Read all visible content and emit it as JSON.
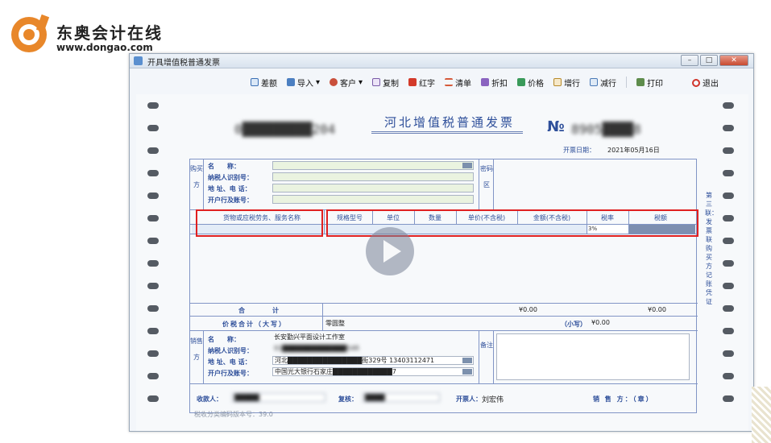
{
  "brand": {
    "name": "东奥会计在线",
    "url": "www.dongao.com",
    "accent": "#e8872a"
  },
  "window": {
    "title": "开具增值税普通发票",
    "min_icon": "minimize-icon",
    "max_icon": "maximize-icon",
    "close_icon": "close-icon"
  },
  "toolbar": {
    "items": [
      {
        "label": "差额",
        "icon": "diff-icon"
      },
      {
        "label": "导入",
        "icon": "import-icon",
        "arrow": "▾"
      },
      {
        "label": "客户",
        "icon": "customer-icon",
        "arrow": "▾"
      },
      {
        "label": "复制",
        "icon": "copy-icon"
      },
      {
        "label": "红字",
        "icon": "red-letter-icon"
      },
      {
        "label": "清单",
        "icon": "list-icon"
      },
      {
        "label": "折扣",
        "icon": "discount-icon"
      },
      {
        "label": "价格",
        "icon": "price-icon"
      },
      {
        "label": "增行",
        "icon": "add-row-icon"
      },
      {
        "label": "减行",
        "icon": "remove-row-icon"
      },
      {
        "label": "打印",
        "icon": "print-icon"
      }
    ],
    "exit_label": "退出"
  },
  "invoice": {
    "title": "河北增值税普通发票",
    "code_left": "0█████████204",
    "no_mark": "№",
    "no_value": "8905████8",
    "date_label": "开票日期：",
    "date_value": "2021年05月16日",
    "buyer": {
      "side": "购买方",
      "name_label": "名　　称：",
      "tax_label": "纳税人识别号：",
      "addr_label": "地 址、电 话：",
      "bank_label": "开户行及账号："
    },
    "cipher_side": "密码区",
    "grid": {
      "headers": [
        "货物或应税劳务、服务名称",
        "规格型号",
        "单位",
        "数量",
        "单价(不含税)",
        "金额(不含税)",
        "税率",
        "税额"
      ],
      "row": [
        "",
        "",
        "",
        "",
        "",
        "",
        "3%",
        ""
      ]
    },
    "totals": {
      "label": "合　　计",
      "amount": "¥0.00",
      "tax": "¥0.00"
    },
    "total_in_words": {
      "label": "价税合计（大写）",
      "value": "零圆整",
      "small_label": "（小写）",
      "small_value": "¥0.00"
    },
    "seller": {
      "side": "销售方",
      "name_label": "名　　称：",
      "name_value": "长安勤兴平面设计工作室",
      "tax_label": "纳税人识别号：",
      "tax_value": "91█████████████54R",
      "addr_label": "地 址、电 话：",
      "addr_value": "河北███████████████街329号 13403112471",
      "bank_label": "开户行及账号：",
      "bank_value": "中国光大银行石家庄████████████7"
    },
    "remarks_side": "备注",
    "side_note": "第三联：发票联 购买方记账凭证",
    "footer": {
      "payee_label": "收款人：",
      "payee_value": "█████",
      "review_label": "复核：",
      "review_value": "████",
      "issuer_label": "开票人：",
      "issuer_value": "刘宏伟",
      "seller_label": "销 售 方：（章）"
    },
    "version": "税收分类编码版本号：39.0"
  },
  "colors": {
    "invoice_blue": "#2e4f9a",
    "highlight_red": "#e02020",
    "line_blue": "#8195c6"
  }
}
